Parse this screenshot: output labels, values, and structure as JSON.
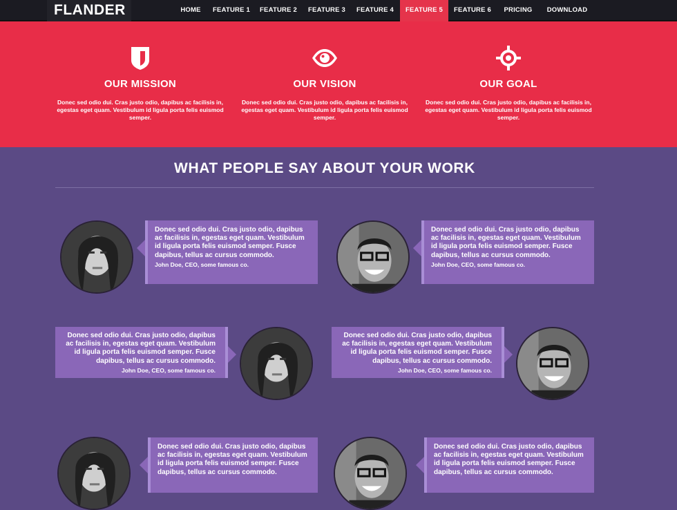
{
  "nav": {
    "logo": "FLANDER",
    "items": [
      {
        "label": "HOME"
      },
      {
        "label": "FEATURE 1"
      },
      {
        "label": "FEATURE 2"
      },
      {
        "label": "FEATURE 3"
      },
      {
        "label": "FEATURE 4"
      },
      {
        "label": "FEATURE 5",
        "active": true
      },
      {
        "label": "FEATURE 6"
      },
      {
        "label": "PRICING"
      },
      {
        "label": "DOWNLOAD"
      }
    ]
  },
  "features": [
    {
      "icon": "shield-icon",
      "title": "OUR MISSION",
      "text": "Donec sed odio dui. Cras justo odio, dapibus ac facilisis in, egestas eget quam. Vestibulum id ligula porta felis euismod semper."
    },
    {
      "icon": "eye-icon",
      "title": "OUR VISION",
      "text": "Donec sed odio dui. Cras justo odio, dapibus ac facilisis in, egestas eget quam. Vestibulum id ligula porta felis euismod semper."
    },
    {
      "icon": "crosshair-icon",
      "title": "OUR GOAL",
      "text": "Donec sed odio dui. Cras justo odio, dapibus ac facilisis in, egestas eget quam. Vestibulum id ligula porta felis euismod semper."
    }
  ],
  "testimonials": {
    "title": "WHAT PEOPLE SAY ABOUT YOUR WORK",
    "quote": "Donec sed odio dui. Cras justo odio, dapibus ac facilisis in, egestas eget quam. Vestibulum id ligula porta felis euismod semper. Fusce dapibus, tellus ac cursus commodo.",
    "author": "John Doe, CEO, some famous co."
  },
  "colors": {
    "nav_bg": "#1b1b22",
    "active": "#e5344b",
    "features_bg": "#e82d48",
    "testimonials_bg": "#5b4a85",
    "bubble": "#8a67b8"
  }
}
